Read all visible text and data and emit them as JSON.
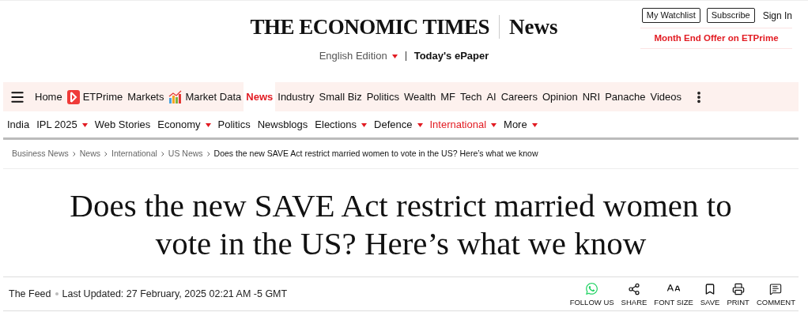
{
  "header": {
    "logo": "THE ECONOMIC TIMES",
    "section": "News",
    "edition": "English Edition",
    "epaper": "Today's ePaper",
    "buttons": [
      "My Watchlist",
      "Subscribe"
    ],
    "sign_in": "Sign In",
    "offer": "Month End Offer on ETPrime"
  },
  "primary_nav": [
    {
      "label": "Home",
      "selected": false
    },
    {
      "label": "ETPrime",
      "selected": false,
      "kind": "prime"
    },
    {
      "label": "Markets",
      "selected": false
    },
    {
      "label": "Market Data",
      "selected": false,
      "kind": "chart"
    },
    {
      "label": "News",
      "selected": true
    },
    {
      "label": "Industry",
      "selected": false
    },
    {
      "label": "Small Biz",
      "selected": false
    },
    {
      "label": "Politics",
      "selected": false
    },
    {
      "label": "Wealth",
      "selected": false
    },
    {
      "label": "MF",
      "selected": false
    },
    {
      "label": "Tech",
      "selected": false
    },
    {
      "label": "AI",
      "selected": false
    },
    {
      "label": "Careers",
      "selected": false
    },
    {
      "label": "Opinion",
      "selected": false
    },
    {
      "label": "NRI",
      "selected": false
    },
    {
      "label": "Panache",
      "selected": false
    },
    {
      "label": "Videos",
      "selected": false
    }
  ],
  "secondary_nav": [
    {
      "label": "India",
      "selected": false,
      "dropdown": false
    },
    {
      "label": "IPL 2025",
      "selected": false,
      "dropdown": true
    },
    {
      "label": "Web Stories",
      "selected": false,
      "dropdown": false
    },
    {
      "label": "Economy",
      "selected": false,
      "dropdown": true
    },
    {
      "label": "Politics",
      "selected": false,
      "dropdown": false
    },
    {
      "label": "Newsblogs",
      "selected": false,
      "dropdown": false
    },
    {
      "label": "Elections",
      "selected": false,
      "dropdown": true
    },
    {
      "label": "Defence",
      "selected": false,
      "dropdown": true
    },
    {
      "label": "International",
      "selected": true,
      "dropdown": true
    },
    {
      "label": "More",
      "selected": false,
      "dropdown": true
    }
  ],
  "breadcrumb": [
    "Business News",
    "News",
    "International",
    "US News",
    "Does the new SAVE Act restrict married women to vote in the US? Here’s what we know"
  ],
  "headline": "Does the new SAVE Act restrict married women to vote in the US? Here’s what we know",
  "meta": {
    "source": "The Feed",
    "updated": "Last Updated: 27 February, 2025 02:21 AM -5 GMT"
  },
  "actions": [
    {
      "kind": "whatsapp",
      "label": "FOLLOW US"
    },
    {
      "kind": "share",
      "label": "SHARE"
    },
    {
      "kind": "fontsize",
      "label": "FONT SIZE"
    },
    {
      "kind": "save",
      "label": "SAVE"
    },
    {
      "kind": "print",
      "label": "PRINT"
    },
    {
      "kind": "comment",
      "label": "COMMENT"
    }
  ]
}
